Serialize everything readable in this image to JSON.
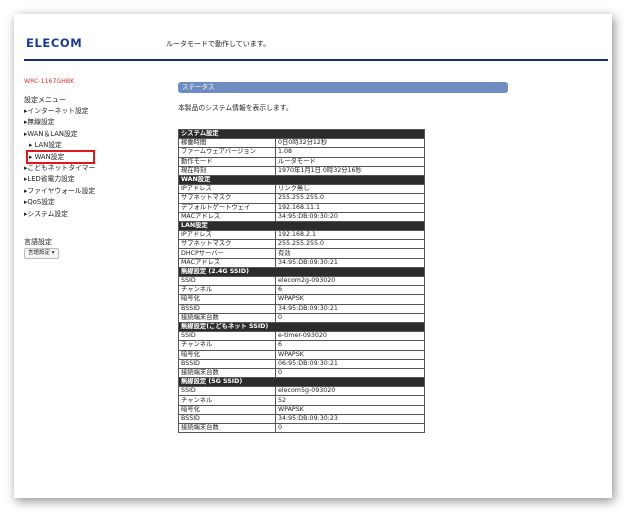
{
  "header": {
    "logo": "ELECOM",
    "mode_text": "ルータモードで動作しています。"
  },
  "sidebar": {
    "model": "WRC-1167GHBK",
    "menu_title": "設定メニュー",
    "items": [
      {
        "label": "▸インターネット設定"
      },
      {
        "label": "▸無線設定"
      },
      {
        "label": "▸WAN＆LAN設定"
      },
      {
        "label": "▸ LAN設定",
        "sub": true
      },
      {
        "label": "▸ WAN設定",
        "sub": true
      },
      {
        "label": "▸こどもネットタイマー"
      },
      {
        "label": "▸LED省電力設定"
      },
      {
        "label": "▸ファイヤウォール設定"
      },
      {
        "label": "▸QoS設定"
      },
      {
        "label": "▸システム設定"
      }
    ],
    "lang_title": "言語設定",
    "lang_select": "言語設定 ▾"
  },
  "main": {
    "section_title": "ステータス",
    "description": "本製品のシステム情報を表示します。",
    "sections": [
      {
        "title": "システム設定",
        "rows": [
          [
            "稼働時間",
            "0日0時32分12秒"
          ],
          [
            "ファームウェアバージョン",
            "1.08"
          ],
          [
            "動作モード",
            "ルータモード"
          ],
          [
            "現在時刻",
            "1970年1月1日 0時32分16秒"
          ]
        ]
      },
      {
        "title": "WAN設定",
        "rows": [
          [
            "IPアドレス",
            "リンク無し"
          ],
          [
            "サブネットマスク",
            "255.255.255.0"
          ],
          [
            "デフォルトゲートウェイ",
            "192.168.11.1"
          ],
          [
            "MACアドレス",
            "34:95:DB:09:30:20"
          ]
        ]
      },
      {
        "title": "LAN設定",
        "rows": [
          [
            "IPアドレス",
            "192.168.2.1"
          ],
          [
            "サブネットマスク",
            "255.255.255.0"
          ],
          [
            "DHCPサーバー",
            "有効"
          ],
          [
            "MACアドレス",
            "34:95:DB:09:30:21"
          ]
        ]
      },
      {
        "title": "無線設定 (2.4G SSID)",
        "rows": [
          [
            "SSID",
            "elecom2g-093020"
          ],
          [
            "チャンネル",
            "6"
          ],
          [
            "暗号化",
            "WPAPSK"
          ],
          [
            "BSSID",
            "34:95:DB:09:30:21"
          ],
          [
            "接続端末台数",
            "0"
          ]
        ]
      },
      {
        "title": "無線設定(こどもネット SSID)",
        "rows": [
          [
            "SSID",
            "e-timer-093020"
          ],
          [
            "チャンネル",
            "6"
          ],
          [
            "暗号化",
            "WPAPSK"
          ],
          [
            "BSSID",
            "06:95:DB:09:30:21"
          ],
          [
            "接続端末台数",
            "0"
          ]
        ]
      },
      {
        "title": "無線設定 (5G SSID)",
        "rows": [
          [
            "SSID",
            "elecom5g-093020"
          ],
          [
            "チャンネル",
            "52"
          ],
          [
            "暗号化",
            "WPAPSK"
          ],
          [
            "BSSID",
            "34:95:DB:09:30:23"
          ],
          [
            "接続端末台数",
            "0"
          ]
        ]
      }
    ]
  }
}
